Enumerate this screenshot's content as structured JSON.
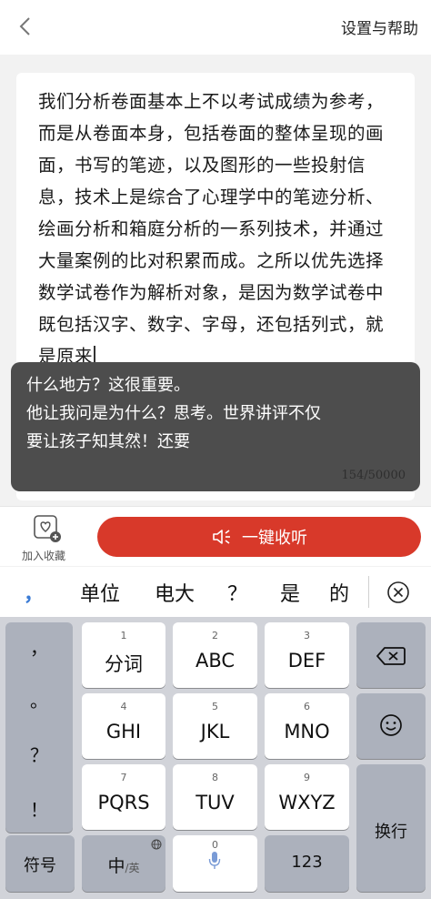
{
  "header": {
    "title": "设置与帮助"
  },
  "article": {
    "text": "我们分析卷面基本上不以考试成绩为参考，而是从卷面本身，包括卷面的整体呈现的画面，书写的笔迹，以及图形的一些投射信息，技术上是综合了心理学中的笔迹分析、绘画分析和箱庭分析的一系列技术，并通过大量案例的比对积累而成。之所以优先选择数学试卷作为解析对象，是因为数学试卷中既包括汉字、数字、字母，还包括列式，就是原来"
  },
  "overlay": {
    "lines": [
      "什么地方？这很重要。",
      "他让我问是为什么？思考。世界讲评不仅",
      "要让孩子知其然！还要"
    ],
    "counter": "154/50000"
  },
  "actions": {
    "collect_label": "加入收藏",
    "listen_label": "一键收听",
    "accent_color": "#d8392a"
  },
  "candidates": {
    "comma": "，",
    "words": [
      "单位",
      "电大",
      "？",
      "是",
      "的"
    ],
    "close_icon": "close-circle-icon"
  },
  "keyboard": {
    "punctuation": [
      "，",
      "。",
      "？",
      "！"
    ],
    "keys": {
      "k1": {
        "main": "分词",
        "sub": "1"
      },
      "k2": {
        "main": "ABC",
        "sub": "2"
      },
      "k3": {
        "main": "DEF",
        "sub": "3"
      },
      "k4": {
        "main": "GHI",
        "sub": "4"
      },
      "k5": {
        "main": "JKL",
        "sub": "5"
      },
      "k6": {
        "main": "MNO",
        "sub": "6"
      },
      "k7": {
        "main": "PQRS",
        "sub": "7"
      },
      "k8": {
        "main": "TUV",
        "sub": "8"
      },
      "k9": {
        "main": "WXYZ",
        "sub": "9"
      }
    },
    "delete_icon": "backspace-icon",
    "emoji_icon": "smiley-icon",
    "enter_label": "换行",
    "symbol_label": "符号",
    "lang_main": "中",
    "lang_sub": "/英",
    "space_sub": "0",
    "num_label": "123"
  }
}
